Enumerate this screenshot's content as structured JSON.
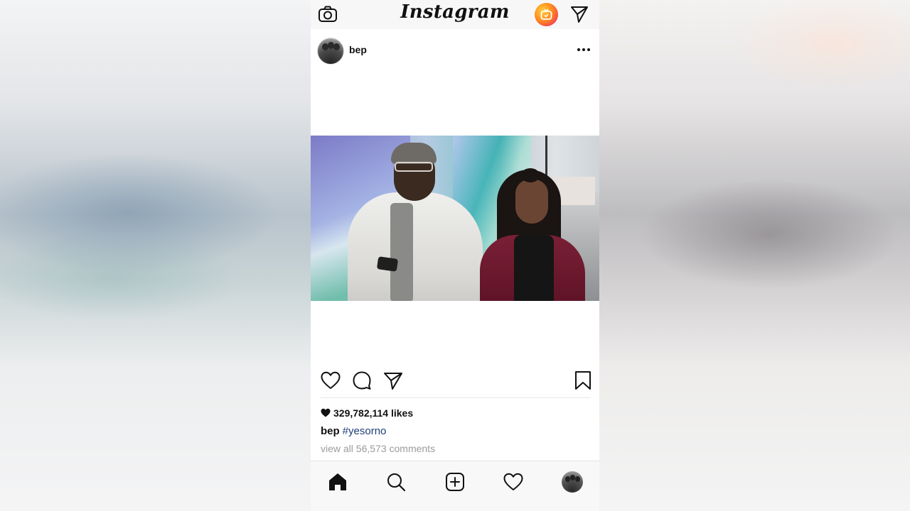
{
  "header": {
    "logo_text": "Instagram"
  },
  "post": {
    "username": "bep",
    "likes_text": "329,782,114 likes",
    "caption_user": "bep",
    "caption_hashtag": "#yesorno",
    "comments_link": "view all 56,573 comments"
  },
  "icons": {
    "top_left": "camera-icon",
    "top_igtv": "igtv-icon",
    "top_right": "direct-send-icon",
    "post_menu": "more-options-icon",
    "actions": [
      "heart-icon",
      "comment-icon",
      "share-icon",
      "bookmark-icon"
    ],
    "tabs": [
      "home-icon",
      "search-icon",
      "add-post-icon",
      "activity-heart-icon",
      "profile-avatar"
    ]
  },
  "colors": {
    "hashtag": "#1e3d74",
    "muted_text": "#9b9b9b",
    "igtv_gradient": [
      "#ffcf3f",
      "#ff8a1f",
      "#f2355a"
    ]
  }
}
